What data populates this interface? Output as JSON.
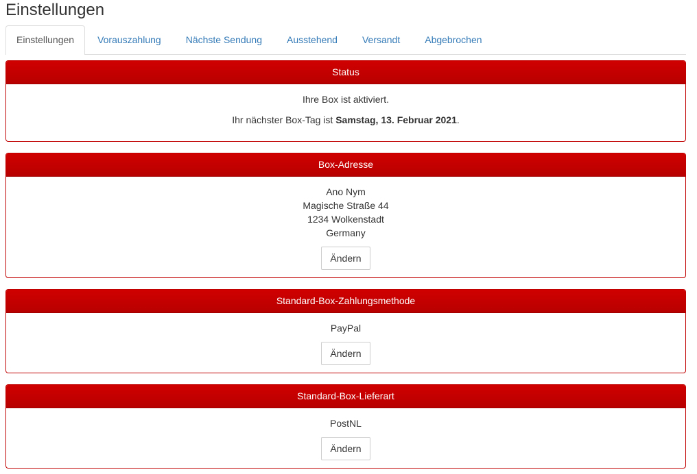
{
  "page": {
    "title": "Einstellungen"
  },
  "tabs": [
    {
      "label": "Einstellungen",
      "active": true
    },
    {
      "label": "Vorauszahlung",
      "active": false
    },
    {
      "label": "Nächste Sendung",
      "active": false
    },
    {
      "label": "Ausstehend",
      "active": false
    },
    {
      "label": "Versandt",
      "active": false
    },
    {
      "label": "Abgebrochen",
      "active": false
    }
  ],
  "status": {
    "heading": "Status",
    "line1": "Ihre Box ist aktiviert.",
    "line2_prefix": "Ihr nächster Box-Tag ist ",
    "line2_date": "Samstag, 13. Februar 2021",
    "line2_suffix": "."
  },
  "address": {
    "heading": "Box-Adresse",
    "name": "Ano Nym",
    "street": "Magische Straße 44",
    "city": "1234 Wolkenstadt",
    "country": "Germany",
    "button": "Ändern"
  },
  "payment": {
    "heading": "Standard-Box-Zahlungsmethode",
    "method": "PayPal",
    "button": "Ändern"
  },
  "delivery": {
    "heading": "Standard-Box-Lieferart",
    "method": "PostNL",
    "button": "Ändern"
  },
  "colors": {
    "panel_header": "#c00000",
    "link": "#337ab7"
  }
}
